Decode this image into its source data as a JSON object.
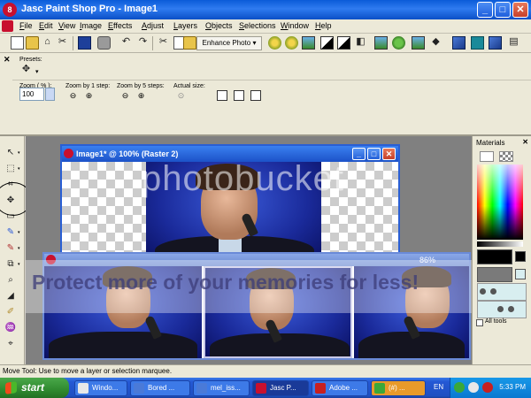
{
  "window": {
    "title": "Jasc Paint Shop Pro - Image1",
    "min": "_",
    "max": "□",
    "close": "✕"
  },
  "menu": [
    "File",
    "Edit",
    "View",
    "Image",
    "Effects",
    "Adjust",
    "Layers",
    "Objects",
    "Selections",
    "Window",
    "Help"
  ],
  "toolbar": {
    "enhance_label": "Enhance Photo ▾"
  },
  "tool_options": {
    "presets_label": "Presets:",
    "zoom_pct_label": "Zoom ( % ):",
    "zoom_value": "100",
    "zoom_step1_label": "Zoom by 1 step:",
    "zoom_step5_label": "Zoom by 5 steps:",
    "actual_size_label": "Actual size:"
  },
  "image_windows": [
    {
      "title": "Image1* @ 100% (Raster 2)",
      "min": "_",
      "max": "□",
      "close": "✕"
    },
    {
      "zoom": "86%"
    }
  ],
  "materials": {
    "title": "Materials",
    "all_tools": "All tools"
  },
  "status": "Move Tool: Use to move a layer or selection marquee.",
  "taskbar": {
    "start": "start",
    "tasks": [
      "Windo...",
      "Bored ...",
      "mel_iss...",
      "Jasc P...",
      "Adobe ...",
      "(#) ..."
    ],
    "lang": "EN",
    "clock": "5:33 PM"
  },
  "watermark": {
    "logo": "photobucket",
    "tagline": "Protect more of your memories for less!"
  }
}
